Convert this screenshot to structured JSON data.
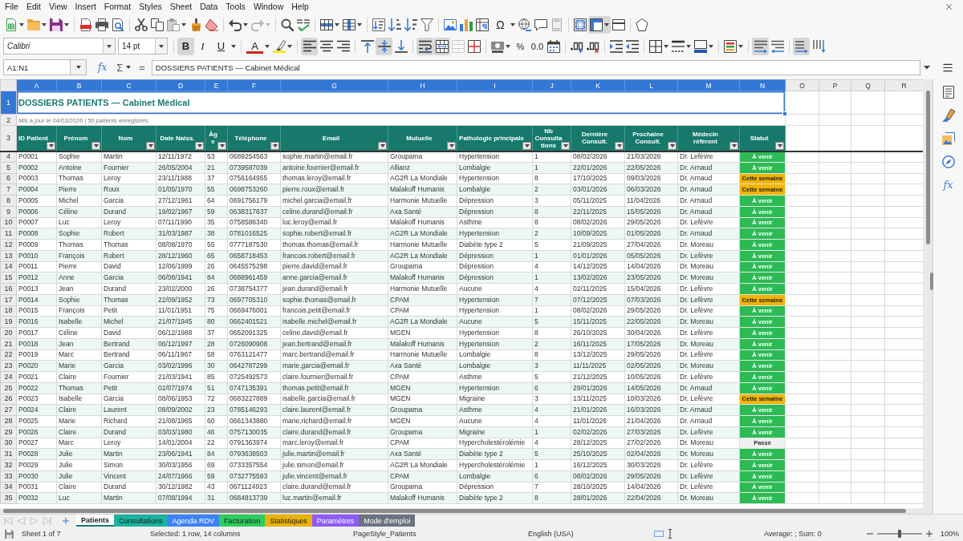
{
  "menu_bar": {
    "items": [
      "File",
      "Edit",
      "View",
      "Insert",
      "Format",
      "Styles",
      "Sheet",
      "Data",
      "Tools",
      "Window",
      "Help"
    ]
  },
  "standard_toolbar": {
    "special_character": "Ω",
    "redo_disabled": true,
    "freeze_rows_and_columns": true
  },
  "formatting_bar": {
    "font_name": "Calibri",
    "font_size": "14 pt",
    "bold": {
      "label": "B",
      "on": true
    },
    "italic": {
      "label": "I",
      "on": false
    },
    "underline": {
      "label": "U",
      "on": false
    },
    "font_color": "A",
    "horizontal_align": [
      {
        "kind": "left",
        "on": true
      },
      {
        "kind": "center",
        "on": false
      },
      {
        "kind": "right",
        "on": false
      }
    ],
    "vertical_align": [
      {
        "kind": "top",
        "on": false
      },
      {
        "kind": "middle",
        "on": true
      },
      {
        "kind": "bottom",
        "on": false
      }
    ],
    "wrap_text": true,
    "merge_and_center": true,
    "merge_cells_disabled": true,
    "percent": "%",
    "number_format": "0.0",
    "paragraph_direction": [
      {
        "kind": "ltr",
        "on": true
      },
      {
        "kind": "rtl",
        "on": false
      }
    ],
    "text_orientation": [
      {
        "kind": "horizontal",
        "on": true
      },
      {
        "kind": "vertical",
        "on": false
      }
    ]
  },
  "formula_bar": {
    "name_box": "A1:N1",
    "function_wizard": "fx",
    "sum": "Σ",
    "equals": "=",
    "content": "DOSSIERS PATIENTS — Cabinet Médical"
  },
  "sheet": {
    "columns": [
      {
        "letter": "A",
        "selected": true
      },
      {
        "letter": "B",
        "selected": true
      },
      {
        "letter": "C",
        "selected": true
      },
      {
        "letter": "D",
        "selected": true
      },
      {
        "letter": "E",
        "selected": true
      },
      {
        "letter": "F",
        "selected": true
      },
      {
        "letter": "G",
        "selected": true
      },
      {
        "letter": "H",
        "selected": true
      },
      {
        "letter": "I",
        "selected": true
      },
      {
        "letter": "J",
        "selected": true
      },
      {
        "letter": "K",
        "selected": true
      },
      {
        "letter": "L",
        "selected": true
      },
      {
        "letter": "M",
        "selected": true
      },
      {
        "letter": "N",
        "selected": true
      },
      {
        "letter": "O",
        "selected": false
      },
      {
        "letter": "P",
        "selected": false
      },
      {
        "letter": "Q",
        "selected": false
      },
      {
        "letter": "R",
        "selected": false
      }
    ],
    "title": {
      "row_number": "1",
      "selected": true,
      "text": "DOSSIERS PATIENTS — Cabinet Médical"
    },
    "subtitle": {
      "row_number": "2",
      "selected": false,
      "text": "Mis à jour le 04/03/2026 | 50 patients enregistrés"
    },
    "header": {
      "row_number": "3",
      "selected": false,
      "labels": [
        "ID Patient",
        "Prénom",
        "Nom",
        "Date Naiss.",
        "Âge",
        "Téléphone",
        "Email",
        "Mutuelle",
        "Pathologie principale",
        "Nb Consultations",
        "Dernière Consult.",
        "Prochaine Consult.",
        "Médecin référent",
        "Statut"
      ]
    },
    "rows": [
      {
        "row_number": "4",
        "selected": false,
        "cells": [
          "P0001",
          "Sophie",
          "Martin",
          "12/11/1972",
          "53",
          "0689254563",
          "sophie.martin@email.fr",
          "Groupama",
          "Hypertension",
          "1",
          "08/02/2026",
          "21/03/2026",
          "Dr. Lefèvre"
        ],
        "status": {
          "label": "À venir",
          "kind": "upcoming"
        }
      },
      {
        "row_number": "5",
        "selected": false,
        "cells": [
          "P0002",
          "Antoine",
          "Fournier",
          "26/05/2004",
          "21",
          "0739587039",
          "antoine.fournier@email.fr",
          "Allianz",
          "Lombalgie",
          "1",
          "22/01/2026",
          "22/05/2026",
          "Dr. Arnaud"
        ],
        "status": {
          "label": "À venir",
          "kind": "upcoming"
        }
      },
      {
        "row_number": "6",
        "selected": false,
        "cells": [
          "P0003",
          "Thomas",
          "Leroy",
          "23/11/1988",
          "37",
          "0756164955",
          "thomas.leroy@email.fr",
          "AG2R La Mondiale",
          "Hypertension",
          "8",
          "17/10/2025",
          "09/03/2026",
          "Dr. Arnaud"
        ],
        "status": {
          "label": "Cette semaine",
          "kind": "this_week"
        }
      },
      {
        "row_number": "7",
        "selected": false,
        "cells": [
          "P0004",
          "Pierre",
          "Roux",
          "01/05/1970",
          "55",
          "0698753260",
          "pierre.roux@email.fr",
          "Malakoff Humanis",
          "Lombalgie",
          "2",
          "03/01/2026",
          "06/03/2026",
          "Dr. Arnaud"
        ],
        "status": {
          "label": "Cette semaine",
          "kind": "this_week"
        }
      },
      {
        "row_number": "8",
        "selected": false,
        "cells": [
          "P0005",
          "Michel",
          "Garcia",
          "27/12/1961",
          "64",
          "0691756179",
          "michel.garcia@email.fr",
          "Harmonie Mutuelle",
          "Dépression",
          "3",
          "05/11/2025",
          "11/04/2026",
          "Dr. Arnaud"
        ],
        "status": {
          "label": "À venir",
          "kind": "upcoming"
        }
      },
      {
        "row_number": "9",
        "selected": false,
        "cells": [
          "P0006",
          "Céline",
          "Durand",
          "19/02/1967",
          "59",
          "0638317637",
          "celine.durand@email.fr",
          "Axa Santé",
          "Dépression",
          "8",
          "22/11/2025",
          "15/05/2026",
          "Dr. Arnaud"
        ],
        "status": {
          "label": "À venir",
          "kind": "upcoming"
        }
      },
      {
        "row_number": "10",
        "selected": false,
        "cells": [
          "P0007",
          "Luc",
          "Leroy",
          "07/11/1990",
          "35",
          "0758586340",
          "luc.leroy@email.fr",
          "Malakoff Humanis",
          "Asthme",
          "8",
          "08/02/2026",
          "29/05/2026",
          "Dr. Lefèvre"
        ],
        "status": {
          "label": "À venir",
          "kind": "upcoming"
        }
      },
      {
        "row_number": "11",
        "selected": false,
        "cells": [
          "P0008",
          "Sophie",
          "Robert",
          "31/03/1987",
          "38",
          "0781016525",
          "sophie.robert@email.fr",
          "AG2R La Mondiale",
          "Hypertension",
          "2",
          "10/09/2025",
          "01/05/2026",
          "Dr. Arnaud"
        ],
        "status": {
          "label": "À venir",
          "kind": "upcoming"
        }
      },
      {
        "row_number": "12",
        "selected": false,
        "cells": [
          "P0009",
          "Thomas",
          "Thomas",
          "08/08/1970",
          "55",
          "0777187530",
          "thomas.thomas@email.fr",
          "Harmonie Mutuelle",
          "Diabète type 2",
          "5",
          "21/09/2025",
          "27/04/2026",
          "Dr. Moreau"
        ],
        "status": {
          "label": "À venir",
          "kind": "upcoming"
        }
      },
      {
        "row_number": "13",
        "selected": false,
        "cells": [
          "P0010",
          "François",
          "Robert",
          "28/12/1960",
          "65",
          "0658718453",
          "francois.robert@email.fr",
          "AG2R La Mondiale",
          "Dépression",
          "1",
          "01/01/2026",
          "05/05/2026",
          "Dr. Lefèvre"
        ],
        "status": {
          "label": "À venir",
          "kind": "upcoming"
        }
      },
      {
        "row_number": "14",
        "selected": false,
        "cells": [
          "P0011",
          "Pierre",
          "David",
          "12/06/1999",
          "26",
          "0645575298",
          "pierre.david@email.fr",
          "Groupama",
          "Dépression",
          "4",
          "14/12/2025",
          "14/04/2026",
          "Dr. Moreau"
        ],
        "status": {
          "label": "À venir",
          "kind": "upcoming"
        }
      },
      {
        "row_number": "15",
        "selected": false,
        "cells": [
          "P0012",
          "Anne",
          "Garcia",
          "06/08/1941",
          "84",
          "0688961459",
          "anne.garcia@email.fr",
          "Malakoff Humanis",
          "Dépression",
          "1",
          "13/02/2026",
          "23/05/2026",
          "Dr. Moreau"
        ],
        "status": {
          "label": "À venir",
          "kind": "upcoming"
        }
      },
      {
        "row_number": "16",
        "selected": false,
        "cells": [
          "P0013",
          "Jean",
          "Durand",
          "23/02/2000",
          "26",
          "0738754377",
          "jean.durand@email.fr",
          "Harmonie Mutuelle",
          "Aucune",
          "4",
          "02/11/2025",
          "15/04/2026",
          "Dr. Lefèvre"
        ],
        "status": {
          "label": "À venir",
          "kind": "upcoming"
        }
      },
      {
        "row_number": "17",
        "selected": false,
        "cells": [
          "P0014",
          "Sophie",
          "Thomas",
          "22/09/1952",
          "73",
          "0697705310",
          "sophie.thomas@email.fr",
          "CPAM",
          "Hypertension",
          "7",
          "07/12/2025",
          "07/03/2026",
          "Dr. Lefèvre"
        ],
        "status": {
          "label": "Cette semaine",
          "kind": "this_week"
        }
      },
      {
        "row_number": "18",
        "selected": false,
        "cells": [
          "P0015",
          "François",
          "Petit",
          "11/01/1951",
          "75",
          "0669476001",
          "francois.petit@email.fr",
          "CPAM",
          "Hypertension",
          "1",
          "08/02/2026",
          "29/05/2026",
          "Dr. Lefèvre"
        ],
        "status": {
          "label": "À venir",
          "kind": "upcoming"
        }
      },
      {
        "row_number": "19",
        "selected": false,
        "cells": [
          "P0016",
          "Isabelle",
          "Michel",
          "21/07/1945",
          "80",
          "0662401521",
          "isabelle.michel@email.fr",
          "AG2R La Mondiale",
          "Aucune",
          "5",
          "15/11/2025",
          "22/05/2026",
          "Dr. Moreau"
        ],
        "status": {
          "label": "À venir",
          "kind": "upcoming"
        }
      },
      {
        "row_number": "20",
        "selected": false,
        "cells": [
          "P0017",
          "Céline",
          "David",
          "06/12/1988",
          "37",
          "0652091325",
          "celine.david@email.fr",
          "MGEN",
          "Hypertension",
          "8",
          "26/10/2025",
          "30/04/2026",
          "Dr. Lefèvre"
        ],
        "status": {
          "label": "À venir",
          "kind": "upcoming"
        }
      },
      {
        "row_number": "21",
        "selected": false,
        "cells": [
          "P0018",
          "Jean",
          "Bertrand",
          "06/12/1997",
          "28",
          "0726090908",
          "jean.bertrand@email.fr",
          "Malakoff Humanis",
          "Hypertension",
          "2",
          "16/11/2025",
          "17/05/2026",
          "Dr. Moreau"
        ],
        "status": {
          "label": "À venir",
          "kind": "upcoming"
        }
      },
      {
        "row_number": "22",
        "selected": false,
        "cells": [
          "P0019",
          "Marc",
          "Bertrand",
          "06/11/1967",
          "58",
          "0763121477",
          "marc.bertrand@email.fr",
          "Harmonie Mutuelle",
          "Lombalgie",
          "8",
          "13/12/2025",
          "29/05/2026",
          "Dr. Lefèvre"
        ],
        "status": {
          "label": "À venir",
          "kind": "upcoming"
        }
      },
      {
        "row_number": "23",
        "selected": false,
        "cells": [
          "P0020",
          "Marie",
          "Garcia",
          "03/02/1996",
          "30",
          "0642787299",
          "marie.garcia@email.fr",
          "Axa Santé",
          "Lombalgie",
          "3",
          "11/11/2025",
          "02/05/2026",
          "Dr. Moreau"
        ],
        "status": {
          "label": "À venir",
          "kind": "upcoming"
        }
      },
      {
        "row_number": "24",
        "selected": false,
        "cells": [
          "P0021",
          "Claire",
          "Fournier",
          "21/03/1941",
          "85",
          "0725492573",
          "claire.fournier@email.fr",
          "CPAM",
          "Asthme",
          "5",
          "21/12/2025",
          "10/05/2026",
          "Dr. Lefèvre"
        ],
        "status": {
          "label": "À venir",
          "kind": "upcoming"
        }
      },
      {
        "row_number": "25",
        "selected": false,
        "cells": [
          "P0022",
          "Thomas",
          "Petit",
          "02/07/1974",
          "51",
          "0747135391",
          "thomas.petit@email.fr",
          "MGEN",
          "Hypertension",
          "6",
          "29/01/2026",
          "14/05/2026",
          "Dr. Arnaud"
        ],
        "status": {
          "label": "À venir",
          "kind": "upcoming"
        }
      },
      {
        "row_number": "26",
        "selected": false,
        "cells": [
          "P0023",
          "Isabelle",
          "Garcia",
          "08/06/1953",
          "72",
          "0683227889",
          "isabelle.garcia@email.fr",
          "MGEN",
          "Migraine",
          "3",
          "13/11/2025",
          "10/03/2026",
          "Dr. Lefèvre"
        ],
        "status": {
          "label": "Cette semaine",
          "kind": "this_week"
        }
      },
      {
        "row_number": "27",
        "selected": false,
        "cells": [
          "P0024",
          "Claire",
          "Laurent",
          "08/09/2002",
          "23",
          "0785146293",
          "claire.laurent@email.fr",
          "Groupama",
          "Asthme",
          "4",
          "21/01/2026",
          "16/03/2026",
          "Dr. Arnaud"
        ],
        "status": {
          "label": "À venir",
          "kind": "upcoming"
        }
      },
      {
        "row_number": "28",
        "selected": false,
        "cells": [
          "P0025",
          "Marie",
          "Richard",
          "21/08/1965",
          "60",
          "0661343880",
          "marie.richard@email.fr",
          "MGEN",
          "Aucune",
          "4",
          "11/01/2026",
          "21/04/2026",
          "Dr. Arnaud"
        ],
        "status": {
          "label": "À venir",
          "kind": "upcoming"
        }
      },
      {
        "row_number": "29",
        "selected": false,
        "cells": [
          "P0026",
          "Claire",
          "Durand",
          "03/03/1980",
          "46",
          "0757130035",
          "claire.durand@email.fr",
          "Groupama",
          "Migraine",
          "1",
          "02/02/2026",
          "27/03/2026",
          "Dr. Lefèvre"
        ],
        "status": {
          "label": "À venir",
          "kind": "upcoming"
        }
      },
      {
        "row_number": "30",
        "selected": false,
        "cells": [
          "P0027",
          "Marc",
          "Leroy",
          "14/01/2004",
          "22",
          "0791363974",
          "marc.leroy@email.fr",
          "CPAM",
          "Hypercholestérolémie",
          "4",
          "28/12/2025",
          "27/02/2026",
          "Dr. Moreau"
        ],
        "status": {
          "label": "Passé",
          "kind": "past"
        }
      },
      {
        "row_number": "31",
        "selected": false,
        "cells": [
          "P0028",
          "Julie",
          "Martin",
          "23/06/1941",
          "84",
          "0793638503",
          "julie.martin@email.fr",
          "Axa Santé",
          "Diabète type 2",
          "5",
          "25/10/2025",
          "02/04/2026",
          "Dr. Moreau"
        ],
        "status": {
          "label": "À venir",
          "kind": "upcoming"
        }
      },
      {
        "row_number": "32",
        "selected": false,
        "cells": [
          "P0029",
          "Julie",
          "Simon",
          "30/03/1956",
          "69",
          "0733357554",
          "julie.simon@email.fr",
          "AG2R La Mondiale",
          "Hypercholestérolémie",
          "1",
          "16/12/2025",
          "30/03/2026",
          "Dr. Lefèvre"
        ],
        "status": {
          "label": "À venir",
          "kind": "upcoming"
        }
      },
      {
        "row_number": "33",
        "selected": false,
        "cells": [
          "P0030",
          "Julie",
          "Vincent",
          "24/07/1966",
          "59",
          "0732775593",
          "julie.vincent@email.fr",
          "CPAM",
          "Lombalgie",
          "6",
          "08/02/2026",
          "29/05/2026",
          "Dr. Lefèvre"
        ],
        "status": {
          "label": "À venir",
          "kind": "upcoming"
        }
      },
      {
        "row_number": "34",
        "selected": false,
        "cells": [
          "P0031",
          "Claire",
          "Durand",
          "30/12/1982",
          "43",
          "0671124923",
          "claire.durand@email.fr",
          "Groupama",
          "Dépression",
          "7",
          "28/10/2025",
          "14/04/2026",
          "Dr. Lefèvre"
        ],
        "status": {
          "label": "À venir",
          "kind": "upcoming"
        }
      },
      {
        "row_number": "35",
        "selected": false,
        "cells": [
          "P0032",
          "Luc",
          "Martin",
          "07/08/1994",
          "31",
          "0684813739",
          "luc.martin@email.fr",
          "Malakoff Humanis",
          "Diabète type 2",
          "8",
          "28/01/2026",
          "22/04/2026",
          "Dr. Moreau"
        ],
        "status": {
          "label": "À venir",
          "kind": "upcoming"
        }
      }
    ]
  },
  "sidebar": {
    "functions": "fx"
  },
  "sheet_tabs": [
    {
      "label": "Patients",
      "selected": true,
      "color": "#16796c"
    },
    {
      "label": "Consultations",
      "selected": false,
      "color": "#1ab39f"
    },
    {
      "label": "Agenda RDV",
      "selected": false,
      "color": "#3b82f6"
    },
    {
      "label": "Facturation",
      "selected": false,
      "color": "#2ecc5e"
    },
    {
      "label": "Statistiques",
      "selected": false,
      "color": "#eab308"
    },
    {
      "label": "Paramètres",
      "selected": false,
      "color": "#8b5cf6"
    },
    {
      "label": "Mode d'emploi",
      "selected": false,
      "color": "#6b7280"
    }
  ],
  "status_bar": {
    "sheet": "Sheet 1 of 7",
    "selection": "Selected: 1 row, 14 columns",
    "page_style": "PageStyle_Patients",
    "language": "English (USA)",
    "summary": "Average: ; Sum: 0",
    "zoom": {
      "label": "100%",
      "level": 0.5
    }
  }
}
